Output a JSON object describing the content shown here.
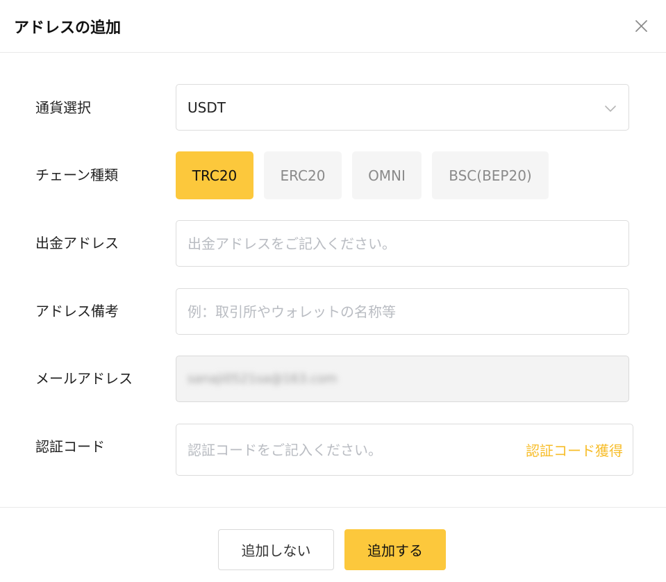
{
  "dialog": {
    "title": "アドレスの追加"
  },
  "form": {
    "currency": {
      "label": "通貨選択",
      "value": "USDT"
    },
    "chain": {
      "label": "チェーン種類",
      "options": [
        "TRC20",
        "ERC20",
        "OMNI",
        "BSC(BEP20)"
      ],
      "selected": "TRC20"
    },
    "withdraw_address": {
      "label": "出金アドレス",
      "placeholder": "出金アドレスをご記入ください。",
      "value": ""
    },
    "address_note": {
      "label": "アドレス備考",
      "placeholder": "例：取引所やウォレットの名称等",
      "value": ""
    },
    "email": {
      "label": "メールアドレス",
      "value": "sanaji0521sa@163.com"
    },
    "verification_code": {
      "label": "認証コード",
      "placeholder": "認証コードをご記入ください。",
      "get_code_label": "認証コード獲得",
      "value": ""
    }
  },
  "footer": {
    "cancel_label": "追加しない",
    "confirm_label": "追加する"
  },
  "colors": {
    "accent": "#fcc83c",
    "link": "#f7bd2a"
  },
  "icons": {
    "close": "close-icon",
    "dropdown": "chevron-down-icon"
  }
}
